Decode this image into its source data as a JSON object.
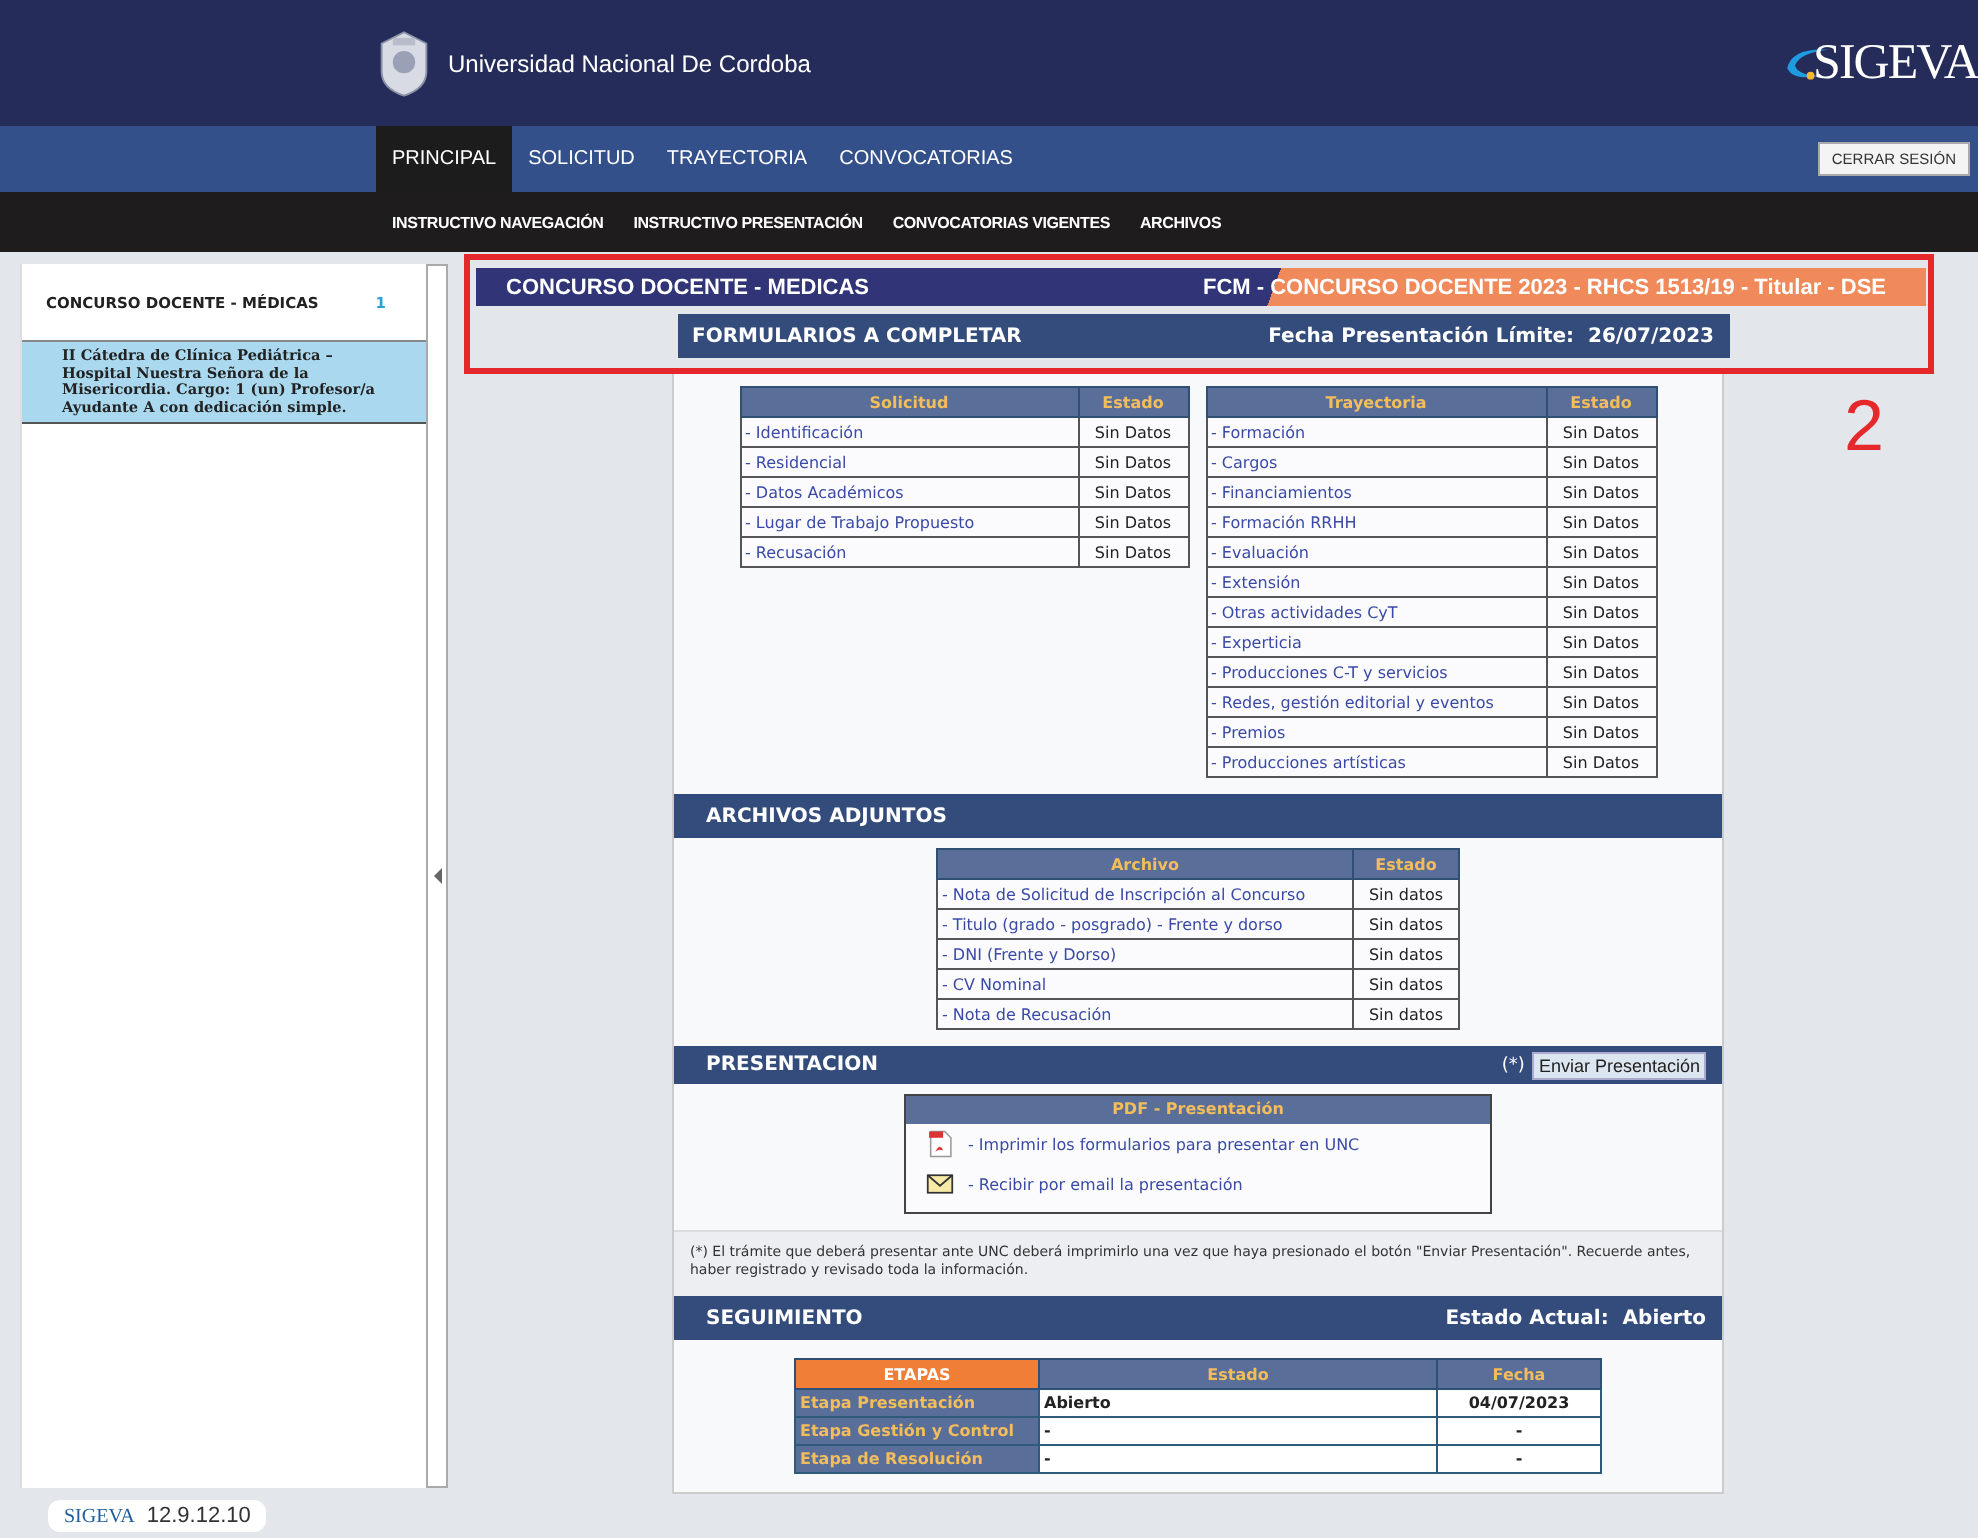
{
  "header": {
    "university": "Universidad Nacional De Cordoba",
    "logo": "SIGEVA"
  },
  "nav": {
    "tabs": [
      {
        "label": "PRINCIPAL",
        "selected": true
      },
      {
        "label": "SOLICITUD",
        "selected": false
      },
      {
        "label": "TRAYECTORIA",
        "selected": false
      },
      {
        "label": "CONVOCATORIAS",
        "selected": false
      }
    ],
    "logout": "CERRAR SESIÓN"
  },
  "subnav": [
    "INSTRUCTIVO NAVEGACIÓN",
    "INSTRUCTIVO PRESENTACIÓN",
    "CONVOCATORIAS VIGENTES",
    "ARCHIVOS"
  ],
  "sidebar": {
    "title": "CONCURSO DOCENTE - MÉDICAS",
    "count": "1",
    "items": [
      {
        "text": "II Cátedra de Clínica Pediátrica – Hospital Nuestra Señora de la Misericordia. Cargo: 1 (un) Profesor/a Ayudante A con dedicación simple.",
        "selected": true
      }
    ]
  },
  "footer": {
    "logo": "SIGEVA",
    "version": "12.9.12.10"
  },
  "banner": {
    "left": "CONCURSO DOCENTE - MEDICAS",
    "right": "FCM - CONCURSO DOCENTE 2023 - RHCS 1513/19 - Titular - DSE"
  },
  "annotation": "2",
  "forms": {
    "title": "FORMULARIOS A COMPLETAR",
    "deadline_label": "Fecha Presentación Límite:",
    "deadline": "26/07/2023"
  },
  "solicitud": {
    "columns": [
      "Solicitud",
      "Estado"
    ],
    "rows": [
      {
        "name": "- Identificación",
        "status": "Sin Datos"
      },
      {
        "name": "- Residencial",
        "status": "Sin Datos"
      },
      {
        "name": "- Datos Académicos",
        "status": "Sin Datos"
      },
      {
        "name": "- Lugar de Trabajo Propuesto",
        "status": "Sin Datos"
      },
      {
        "name": "- Recusación",
        "status": "Sin Datos"
      }
    ]
  },
  "trayectoria": {
    "columns": [
      "Trayectoria",
      "Estado"
    ],
    "rows": [
      {
        "name": "- Formación",
        "status": "Sin Datos"
      },
      {
        "name": "- Cargos",
        "status": "Sin Datos"
      },
      {
        "name": "- Financiamientos",
        "status": "Sin Datos"
      },
      {
        "name": "- Formación RRHH",
        "status": "Sin Datos"
      },
      {
        "name": "- Evaluación",
        "status": "Sin Datos"
      },
      {
        "name": "- Extensión",
        "status": "Sin Datos"
      },
      {
        "name": "- Otras actividades CyT",
        "status": "Sin Datos"
      },
      {
        "name": "- Experticia",
        "status": "Sin Datos"
      },
      {
        "name": "- Producciones C-T y servicios",
        "status": "Sin Datos"
      },
      {
        "name": "- Redes, gestión editorial y eventos",
        "status": "Sin Datos"
      },
      {
        "name": "- Premios",
        "status": "Sin Datos"
      },
      {
        "name": "- Producciones artísticas",
        "status": "Sin Datos"
      }
    ]
  },
  "archivos": {
    "title": "ARCHIVOS ADJUNTOS",
    "columns": [
      "Archivo",
      "Estado"
    ],
    "rows": [
      {
        "name": "- Nota de Solicitud de Inscripción al Concurso",
        "status": "Sin datos"
      },
      {
        "name": "- Titulo (grado - posgrado) - Frente y dorso",
        "status": "Sin datos"
      },
      {
        "name": "- DNI (Frente y Dorso)",
        "status": "Sin datos"
      },
      {
        "name": "- CV Nominal",
        "status": "Sin datos"
      },
      {
        "name": "- Nota de Recusación",
        "status": "Sin datos"
      }
    ]
  },
  "presentacion": {
    "title": "PRESENTACION",
    "marker": "(*)",
    "button": "Enviar Presentación",
    "pdf_title": "PDF - Presentación",
    "links": [
      {
        "kind": "pdf",
        "text": "- Imprimir los formularios para presentar en UNC"
      },
      {
        "kind": "email",
        "text": "- Recibir por email la presentación"
      }
    ],
    "note": "(*) El trámite que deberá presentar ante UNC deberá imprimirlo una vez que haya presionado el botón \"Enviar Presentación\". Recuerde antes, haber registrado y revisado toda la información."
  },
  "seguimiento": {
    "title": "SEGUIMIENTO",
    "estado_label": "Estado Actual:",
    "estado": "Abierto",
    "columns": [
      "ETAPAS",
      "Estado",
      "Fecha"
    ],
    "rows": [
      {
        "etapa": "Etapa Presentación",
        "estado": "Abierto",
        "fecha": "04/07/2023"
      },
      {
        "etapa": "Etapa Gestión y Control",
        "estado": "-",
        "fecha": "-"
      },
      {
        "etapa": "Etapa de Resolución",
        "estado": "-",
        "fecha": "-"
      }
    ]
  }
}
